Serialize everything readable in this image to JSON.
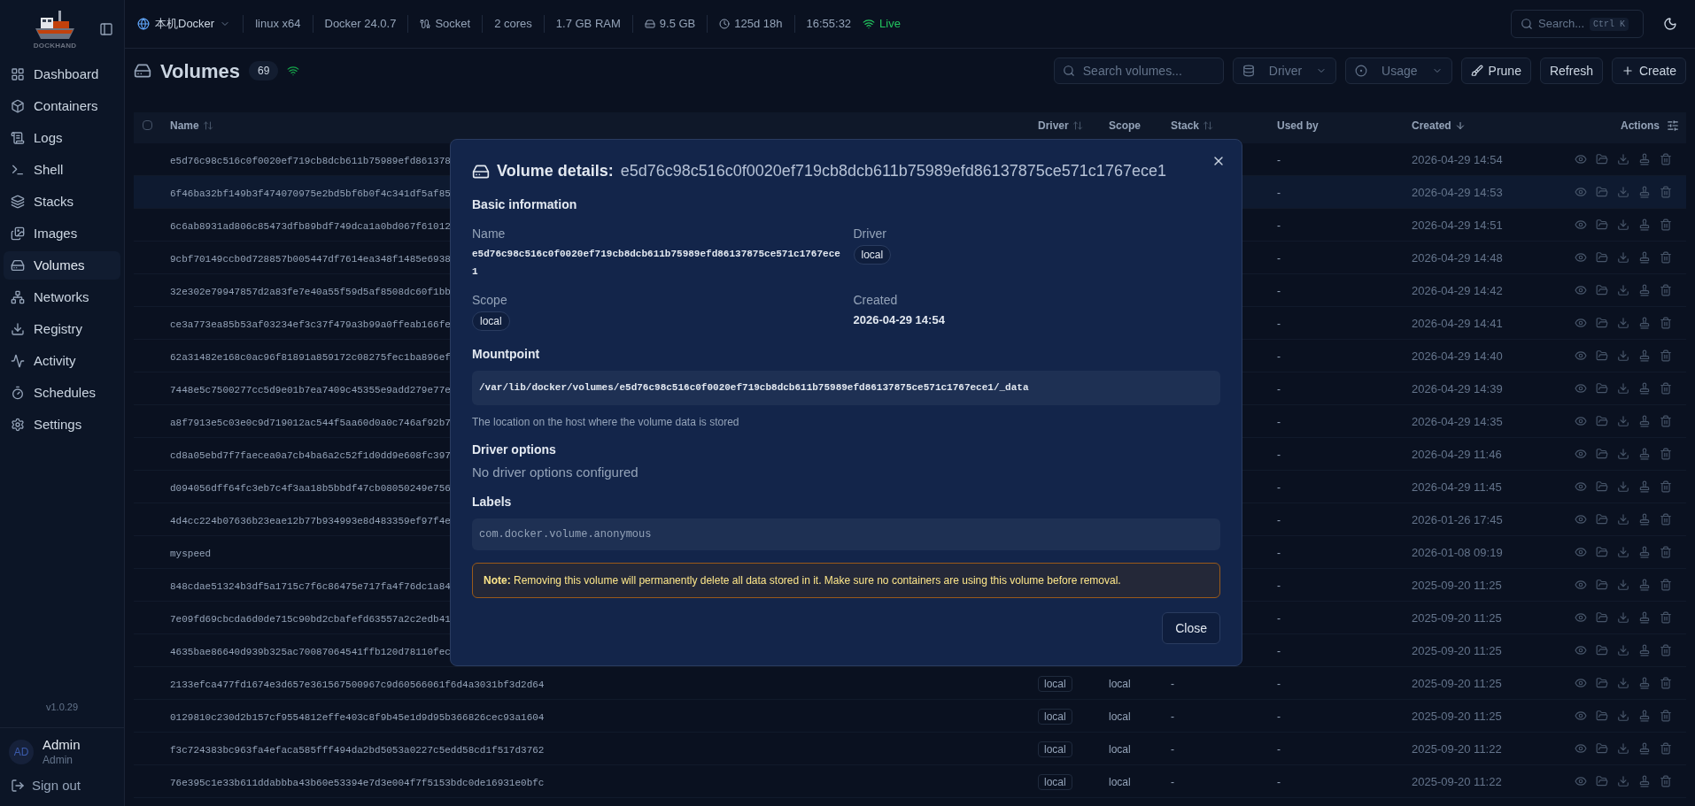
{
  "sidebar": {
    "logo_text": "DOCKHAND",
    "items": [
      {
        "label": "Dashboard",
        "selected": false
      },
      {
        "label": "Containers",
        "selected": false
      },
      {
        "label": "Logs",
        "selected": false
      },
      {
        "label": "Shell",
        "selected": false
      },
      {
        "label": "Stacks",
        "selected": false
      },
      {
        "label": "Images",
        "selected": false
      },
      {
        "label": "Volumes",
        "selected": true
      },
      {
        "label": "Networks",
        "selected": false
      },
      {
        "label": "Registry",
        "selected": false
      },
      {
        "label": "Activity",
        "selected": false
      },
      {
        "label": "Schedules",
        "selected": false
      },
      {
        "label": "Settings",
        "selected": false
      }
    ],
    "version": "v1.0.29",
    "user": {
      "initials": "AD",
      "name": "Admin",
      "role": "Admin"
    },
    "sign_out": "Sign out"
  },
  "top_bar": {
    "environment": "本机Docker",
    "stats": [
      "linux x64",
      "Docker 24.0.7",
      "Socket",
      "2 cores",
      "1.7 GB RAM",
      "9.5 GB",
      "125d 18h",
      "16:55:32"
    ],
    "connection": {
      "label": "Live",
      "live": true
    },
    "search": {
      "placeholder": "Search...",
      "shortcut": "Ctrl K"
    }
  },
  "page": {
    "title": "Volumes",
    "count": "69",
    "search": {
      "placeholder": "Search volumes..."
    },
    "filters": [
      "Driver",
      "Usage"
    ],
    "buttons": [
      "Prune",
      "Refresh",
      "Create"
    ]
  },
  "table": {
    "select_all": {
      "checked": false
    },
    "columns": [
      "Name",
      "Driver",
      "Scope",
      "Stack",
      "Used by",
      "Created",
      "Actions"
    ],
    "rows": [
      {
        "name": "e5d76c98c516c0f0020ef719cb8dcb611b75989efd861378",
        "used_by": "-",
        "created": "2026-04-29 14:54",
        "selected": false
      },
      {
        "name": "6f46ba32bf149b3f474070975e2bd5bf6b0f4c341df5af85",
        "used_by": "-",
        "created": "2026-04-29 14:53",
        "selected": true
      },
      {
        "name": "6c6ab8931ad806c85473dfb89bdf749dca1a0bd067f61012",
        "used_by": "-",
        "created": "2026-04-29 14:51",
        "selected": false
      },
      {
        "name": "9cbf70149ccb0d728857b005447df7614ea348f1485e6938",
        "used_by": "-",
        "created": "2026-04-29 14:48",
        "selected": false
      },
      {
        "name": "32e302e79947857d2a83fe7e40a55f59d5af8508dc60f1bb",
        "used_by": "-",
        "created": "2026-04-29 14:42",
        "selected": false
      },
      {
        "name": "ce3a773ea85b53af03234ef3c37f479a3b99a0ffeab166fe",
        "used_by": "-",
        "created": "2026-04-29 14:41",
        "selected": false
      },
      {
        "name": "62a31482e168c0ac96f81891a859172c08275fec1ba896ef",
        "used_by": "-",
        "created": "2026-04-29 14:40",
        "selected": false
      },
      {
        "name": "7448e5c7500277cc5d9e01b7ea7409c45355e9add279e77e",
        "used_by": "-",
        "created": "2026-04-29 14:39",
        "selected": false
      },
      {
        "name": "a8f7913e5c03e0c9d719012ac544f5aa60d0a0c746af92b7",
        "used_by": "-",
        "created": "2026-04-29 14:35",
        "selected": false
      },
      {
        "name": "cd8a05ebd7f7faecea0a7cb4ba6a2c52f1d0dd9e608fc397",
        "used_by": "-",
        "created": "2026-04-29 11:46",
        "selected": false
      },
      {
        "name": "d094056dff64fc3eb7c4f3aa18b5bbdf47cb08050249e756",
        "used_by": "-",
        "created": "2026-04-29 11:45",
        "selected": false
      },
      {
        "name": "4d4cc224b07636b23eae12b77b934993e8d483359ef97f4e",
        "used_by": "-",
        "created": "2026-01-26 17:45",
        "selected": false
      },
      {
        "name": "myspeed",
        "used_by": "-",
        "created": "2026-01-08 09:19",
        "selected": false
      },
      {
        "name": "848cdae51324b3df5a1715c7f6c86475e717fa4f76dc1a84",
        "used_by": "-",
        "created": "2025-09-20 11:25",
        "selected": false
      },
      {
        "name": "7e09fd69cbcda6d0de715c90bd2cbafefd63557a2c2edb41",
        "used_by": "-",
        "created": "2025-09-20 11:25",
        "selected": false
      },
      {
        "name": "4635bae86640d939b325ac70087064541ffb120d78110fec",
        "used_by": "-",
        "created": "2025-09-20 11:25",
        "selected": false
      },
      {
        "name": "2133efca477fd1674e3d657e361567500967c9d60566061f6d4a3031bf3d2d64",
        "driver": "local",
        "scope": "local",
        "stack": "-",
        "used_by": "-",
        "created": "2025-09-20 11:25",
        "selected": false
      },
      {
        "name": "0129810c230d2b157cf9554812effe403c8f9b45e1d9d95b366826cec93a1604",
        "driver": "local",
        "scope": "local",
        "stack": "-",
        "used_by": "-",
        "created": "2025-09-20 11:25",
        "selected": false
      },
      {
        "name": "f3c724383bc963fa4efaca585fff494da2bd5053a0227c5edd58cd1f517d3762",
        "driver": "local",
        "scope": "local",
        "stack": "-",
        "used_by": "-",
        "created": "2025-09-20 11:22",
        "selected": false
      },
      {
        "name": "76e395c1e33b611ddabbba43b60e53394e7d3e004f7f5153bdc0de16931e0bfc",
        "driver": "local",
        "scope": "local",
        "stack": "-",
        "used_by": "-",
        "created": "2025-09-20 11:22",
        "selected": false
      }
    ]
  },
  "dialog": {
    "title": "Volume details:",
    "subject": "e5d76c98c516c0f0020ef719cb8dcb611b75989efd86137875ce571c1767ece1",
    "basic": {
      "heading": "Basic information",
      "fields": [
        {
          "label": "Name",
          "value": "e5d76c98c516c0f0020ef719cb8dcb611b75989efd86137875ce571c1767ece1",
          "kind": "code"
        },
        {
          "label": "Driver",
          "value": "local",
          "kind": "badge"
        },
        {
          "label": "Scope",
          "value": "local",
          "kind": "badge"
        },
        {
          "label": "Created",
          "value": "2026-04-29 14:54",
          "kind": "text"
        }
      ]
    },
    "mountpoint": {
      "heading": "Mountpoint",
      "value": "/var/lib/docker/volumes/e5d76c98c516c0f0020ef719cb8dcb611b75989efd86137875ce571c1767ece1/_data",
      "hint": "The location on the host where the volume data is stored"
    },
    "driver_options": {
      "heading": "Driver options",
      "text": "No driver options configured"
    },
    "labels": {
      "heading": "Labels",
      "items": [
        "com.docker.volume.anonymous"
      ]
    },
    "note": "**Note:** Removing this volume will permanently delete all data stored in it. Make sure no containers are using this volume before removal.",
    "close": "Close"
  }
}
